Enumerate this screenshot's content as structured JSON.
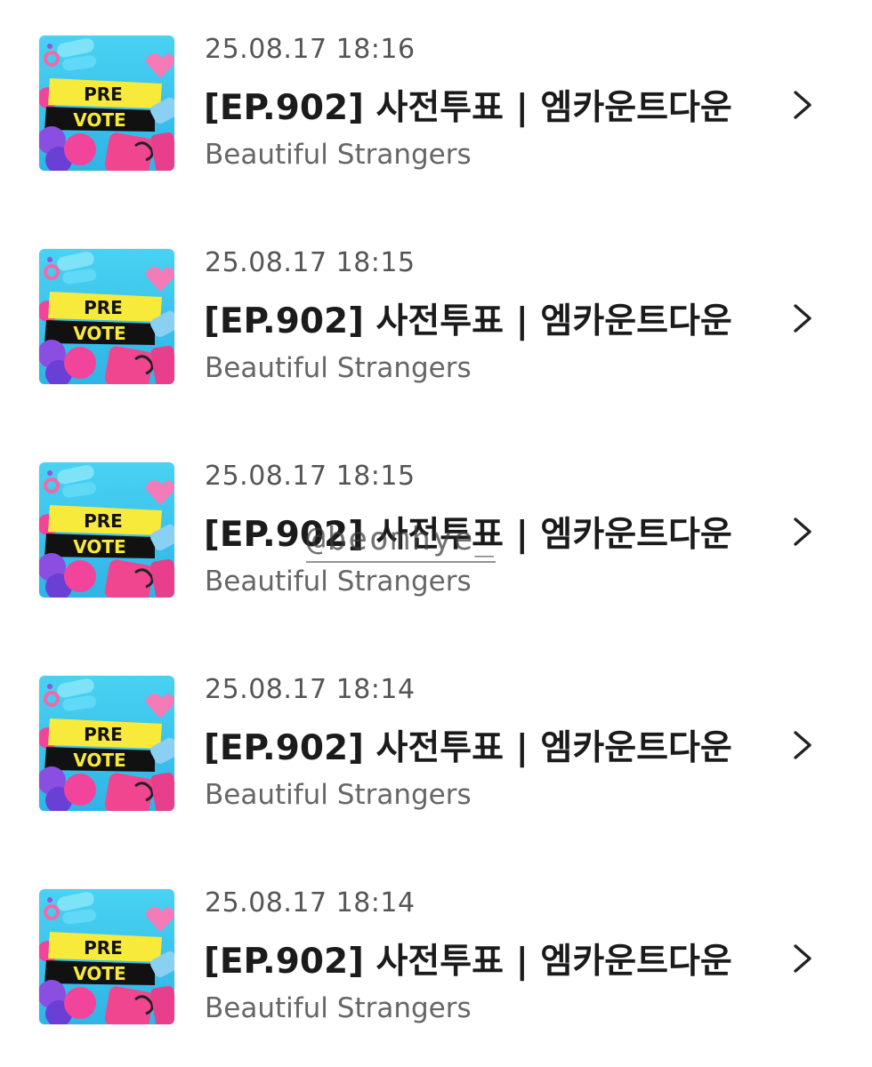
{
  "items": [
    {
      "date": "25.08.17 18:16",
      "title": "[EP.902] 사전투표 | 엠카운트다운",
      "artist": "Beautiful Strangers",
      "thumb_text": [
        "PRE",
        "VOTE"
      ]
    },
    {
      "date": "25.08.17 18:15",
      "title": "[EP.902] 사전투표 | 엠카운트다운",
      "artist": "Beautiful Strangers",
      "thumb_text": [
        "PRE",
        "VOTE"
      ]
    },
    {
      "date": "25.08.17 18:15",
      "title": "[EP.902] 사전투표 | 엠카운트다운",
      "artist": "Beautiful Strangers",
      "thumb_text": [
        "PRE",
        "VOTE"
      ]
    },
    {
      "date": "25.08.17 18:14",
      "title": "[EP.902] 사전투표 | 엠카운트다운",
      "artist": "Beautiful Strangers",
      "thumb_text": [
        "PRE",
        "VOTE"
      ]
    },
    {
      "date": "25.08.17 18:14",
      "title": "[EP.902] 사전투표 | 엠카운트다운",
      "artist": "Beautiful Strangers",
      "thumb_text": [
        "PRE",
        "VOTE"
      ]
    }
  ],
  "watermark": "@beomhye_",
  "icons": {
    "chevron": "chevron-right-icon"
  },
  "colors": {
    "thumb_bg": "#3fc4ec",
    "thumb_band_yellow": "#f7ea3a",
    "thumb_band_black": "#111111",
    "thumb_pink": "#f2449a",
    "thumb_purple": "#6a3fd6",
    "text_date": "#555555",
    "text_title": "#1b1b1b",
    "text_artist": "#666666"
  }
}
